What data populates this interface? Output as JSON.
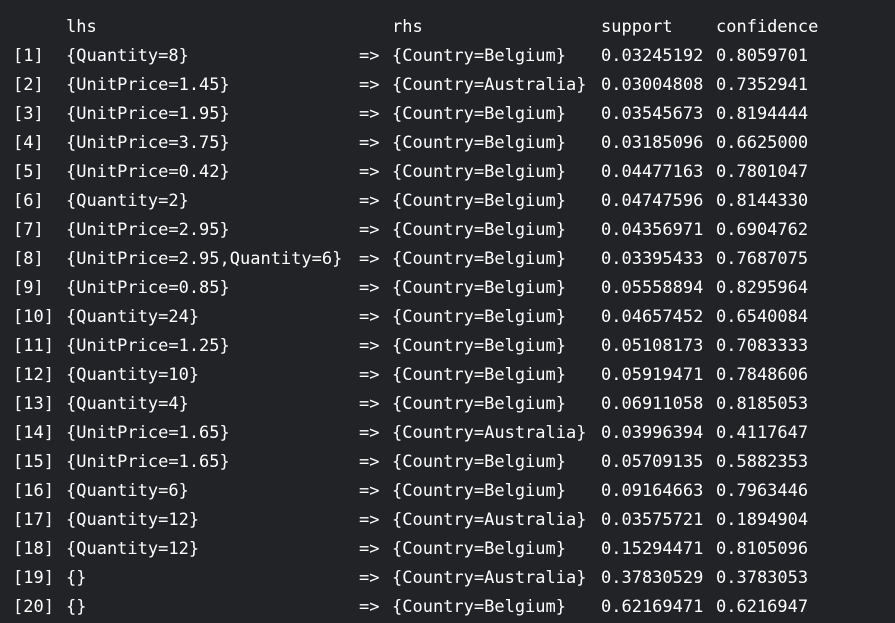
{
  "console": {
    "columns": {
      "lhs": "lhs",
      "rhs": "rhs",
      "support": "support",
      "confidence": "confidence"
    },
    "rows": [
      {
        "index": "[1]",
        "lhs": "{Quantity=8}",
        "arrow": "=>",
        "rhs": "{Country=Belgium}",
        "support": "0.03245192",
        "confidence": "0.8059701"
      },
      {
        "index": "[2]",
        "lhs": "{UnitPrice=1.45}",
        "arrow": "=>",
        "rhs": "{Country=Australia}",
        "support": "0.03004808",
        "confidence": "0.7352941"
      },
      {
        "index": "[3]",
        "lhs": "{UnitPrice=1.95}",
        "arrow": "=>",
        "rhs": "{Country=Belgium}",
        "support": "0.03545673",
        "confidence": "0.8194444"
      },
      {
        "index": "[4]",
        "lhs": "{UnitPrice=3.75}",
        "arrow": "=>",
        "rhs": "{Country=Belgium}",
        "support": "0.03185096",
        "confidence": "0.6625000"
      },
      {
        "index": "[5]",
        "lhs": "{UnitPrice=0.42}",
        "arrow": "=>",
        "rhs": "{Country=Belgium}",
        "support": "0.04477163",
        "confidence": "0.7801047"
      },
      {
        "index": "[6]",
        "lhs": "{Quantity=2}",
        "arrow": "=>",
        "rhs": "{Country=Belgium}",
        "support": "0.04747596",
        "confidence": "0.8144330"
      },
      {
        "index": "[7]",
        "lhs": "{UnitPrice=2.95}",
        "arrow": "=>",
        "rhs": "{Country=Belgium}",
        "support": "0.04356971",
        "confidence": "0.6904762"
      },
      {
        "index": "[8]",
        "lhs": "{UnitPrice=2.95,Quantity=6}",
        "arrow": "=>",
        "rhs": "{Country=Belgium}",
        "support": "0.03395433",
        "confidence": "0.7687075"
      },
      {
        "index": "[9]",
        "lhs": "{UnitPrice=0.85}",
        "arrow": "=>",
        "rhs": "{Country=Belgium}",
        "support": "0.05558894",
        "confidence": "0.8295964"
      },
      {
        "index": "[10]",
        "lhs": "{Quantity=24}",
        "arrow": "=>",
        "rhs": "{Country=Belgium}",
        "support": "0.04657452",
        "confidence": "0.6540084"
      },
      {
        "index": "[11]",
        "lhs": "{UnitPrice=1.25}",
        "arrow": "=>",
        "rhs": "{Country=Belgium}",
        "support": "0.05108173",
        "confidence": "0.7083333"
      },
      {
        "index": "[12]",
        "lhs": "{Quantity=10}",
        "arrow": "=>",
        "rhs": "{Country=Belgium}",
        "support": "0.05919471",
        "confidence": "0.7848606"
      },
      {
        "index": "[13]",
        "lhs": "{Quantity=4}",
        "arrow": "=>",
        "rhs": "{Country=Belgium}",
        "support": "0.06911058",
        "confidence": "0.8185053"
      },
      {
        "index": "[14]",
        "lhs": "{UnitPrice=1.65}",
        "arrow": "=>",
        "rhs": "{Country=Australia}",
        "support": "0.03996394",
        "confidence": "0.4117647"
      },
      {
        "index": "[15]",
        "lhs": "{UnitPrice=1.65}",
        "arrow": "=>",
        "rhs": "{Country=Belgium}",
        "support": "0.05709135",
        "confidence": "0.5882353"
      },
      {
        "index": "[16]",
        "lhs": "{Quantity=6}",
        "arrow": "=>",
        "rhs": "{Country=Belgium}",
        "support": "0.09164663",
        "confidence": "0.7963446"
      },
      {
        "index": "[17]",
        "lhs": "{Quantity=12}",
        "arrow": "=>",
        "rhs": "{Country=Australia}",
        "support": "0.03575721",
        "confidence": "0.1894904"
      },
      {
        "index": "[18]",
        "lhs": "{Quantity=12}",
        "arrow": "=>",
        "rhs": "{Country=Belgium}",
        "support": "0.15294471",
        "confidence": "0.8105096"
      },
      {
        "index": "[19]",
        "lhs": "{}",
        "arrow": "=>",
        "rhs": "{Country=Australia}",
        "support": "0.37830529",
        "confidence": "0.3783053"
      },
      {
        "index": "[20]",
        "lhs": "{}",
        "arrow": "=>",
        "rhs": "{Country=Belgium}",
        "support": "0.62169471",
        "confidence": "0.6216947"
      }
    ]
  }
}
